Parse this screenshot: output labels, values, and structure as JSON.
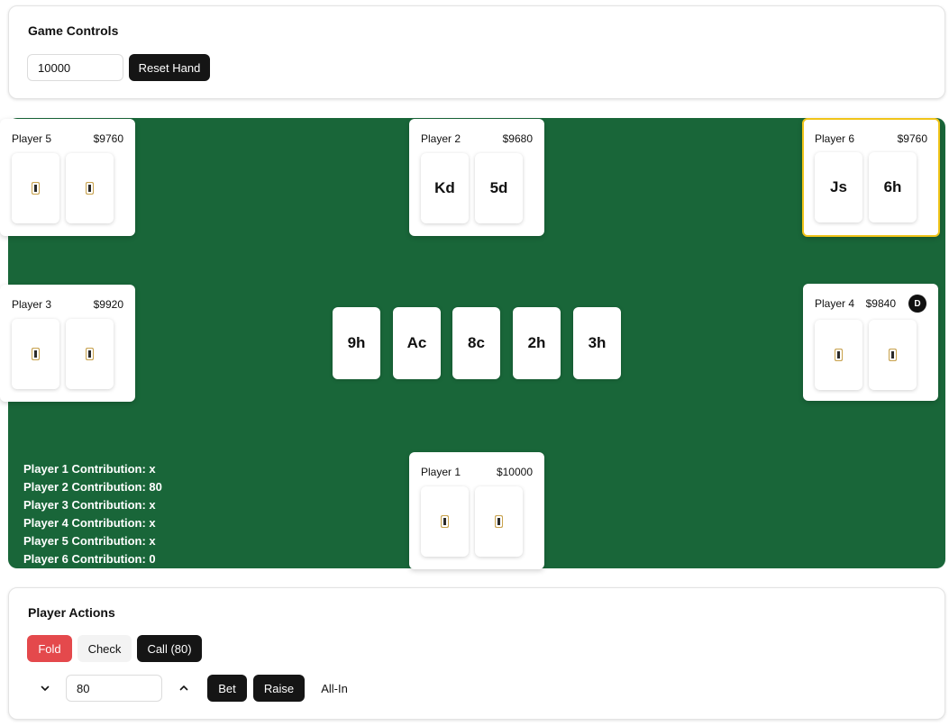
{
  "controls": {
    "title": "Game Controls",
    "stack_input_value": "10000",
    "reset_label": "Reset Hand"
  },
  "seats": [
    {
      "name": "Player 1",
      "stack": "$10000",
      "cards": [
        "",
        ""
      ],
      "hidden": true
    },
    {
      "name": "Player 2",
      "stack": "$9680",
      "cards": [
        "Kd",
        "5d"
      ],
      "hidden": false
    },
    {
      "name": "Player 3",
      "stack": "$9920",
      "cards": [
        "",
        ""
      ],
      "hidden": true
    },
    {
      "name": "Player 4",
      "stack": "$9840",
      "cards": [
        "",
        ""
      ],
      "hidden": true,
      "dealer_label": "D"
    },
    {
      "name": "Player 5",
      "stack": "$9760",
      "cards": [
        "",
        ""
      ],
      "hidden": true
    },
    {
      "name": "Player 6",
      "stack": "$9760",
      "cards": [
        "Js",
        "6h"
      ],
      "hidden": false,
      "active": true
    }
  ],
  "board": [
    "9h",
    "Ac",
    "8c",
    "2h",
    "3h"
  ],
  "contributions": [
    "Player 1 Contribution: x",
    "Player 2 Contribution: 80",
    "Player 3 Contribution: x",
    "Player 4 Contribution: x",
    "Player 5 Contribution: x",
    "Player 6 Contribution: 0"
  ],
  "actions": {
    "title": "Player Actions",
    "fold_label": "Fold",
    "check_label": "Check",
    "call_label": "Call (80)",
    "bet_amount_value": "80",
    "bet_label": "Bet",
    "raise_label": "Raise",
    "allin_label": "All-In"
  },
  "colors": {
    "table_felt": "#196639",
    "active_highlight": "#f0c419",
    "fold": "#e4494c",
    "dark_button": "#151515"
  },
  "icons": {
    "hidden_card": "card-back-icon",
    "decrease": "chevron-down-icon",
    "increase": "chevron-up-icon"
  }
}
